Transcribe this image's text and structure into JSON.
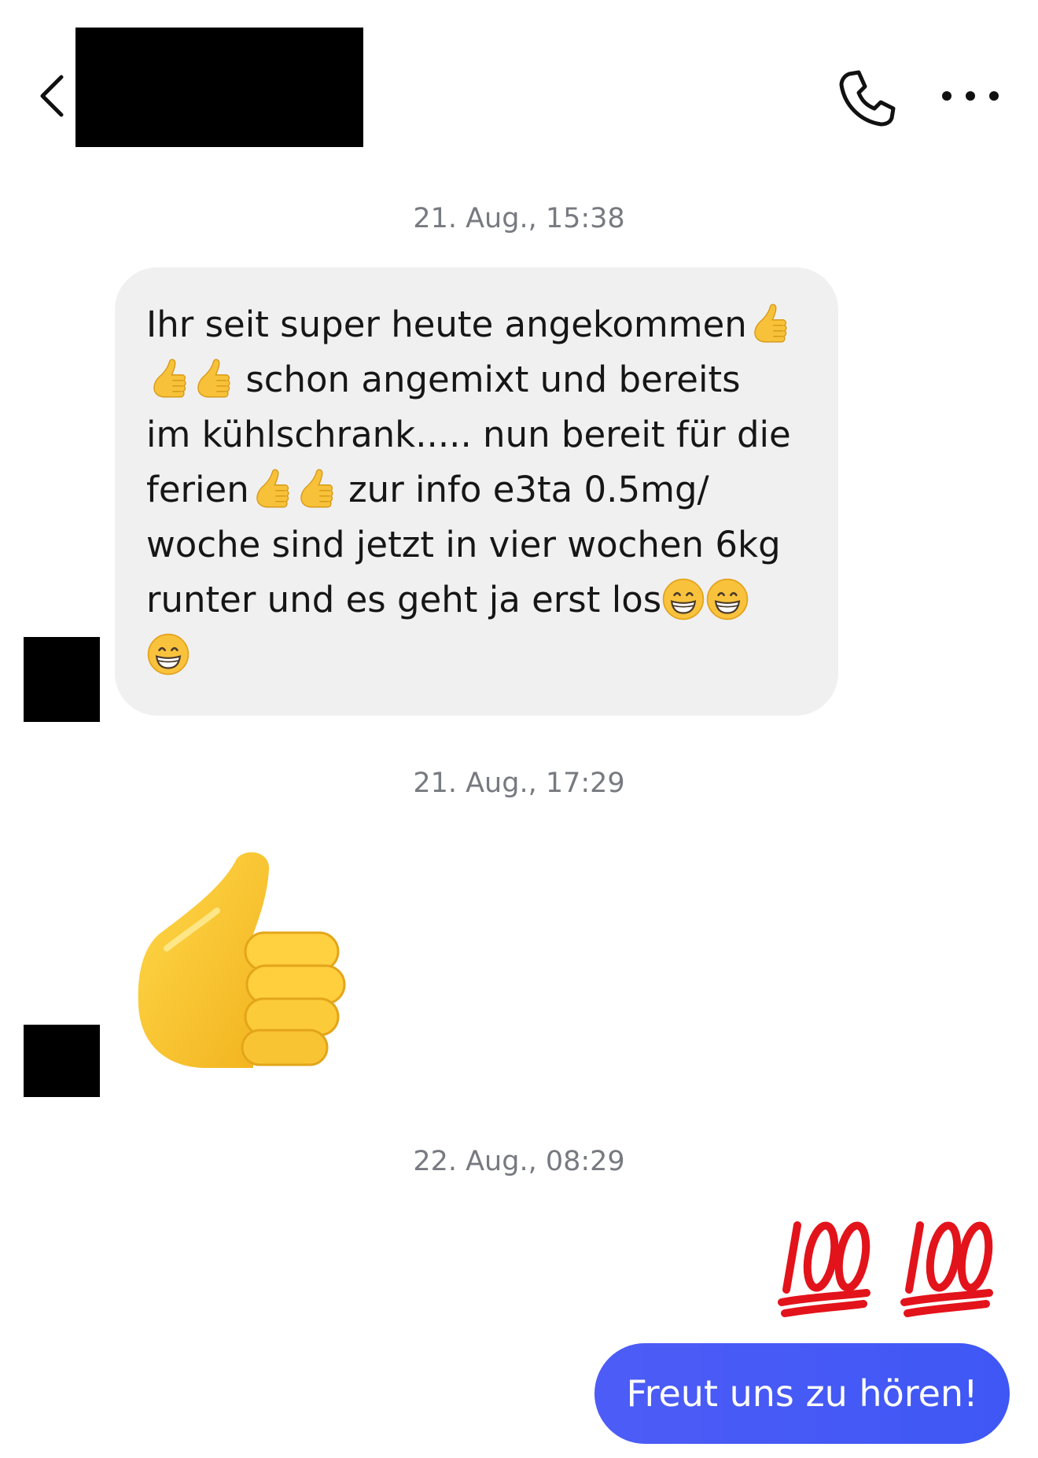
{
  "header": {
    "back_icon": "chevron-left-icon",
    "call_icon": "phone-icon",
    "more_icon": "more-horizontal-icon"
  },
  "messages": [
    {
      "timestamp": "21. Aug., 15:38",
      "direction": "incoming",
      "lines": [
        "Ihr seit super heute angekommen",
        "schon angemixt und bereits",
        "im kühlschrank..... nun bereit für die",
        "ferien",
        "zur info e3ta 0.5mg/",
        "woche sind jetzt in vier wochen 6kg",
        "runter und es geht ja erst los"
      ],
      "emoji": [
        "thumbs-up-emoji",
        "grinning-face-emoji"
      ]
    },
    {
      "timestamp": "21. Aug., 17:29",
      "direction": "incoming",
      "emoji": "thumbs-up-emoji-large"
    },
    {
      "timestamp": "22. Aug., 08:29",
      "direction": "outgoing",
      "emoji": "hundred-points-emoji",
      "text": "Freut uns zu hören!"
    }
  ],
  "colors": {
    "incoming_bubble": "#f0f0f1",
    "outgoing_bubble": "#4d5cf6",
    "timestamp": "#777a80"
  }
}
